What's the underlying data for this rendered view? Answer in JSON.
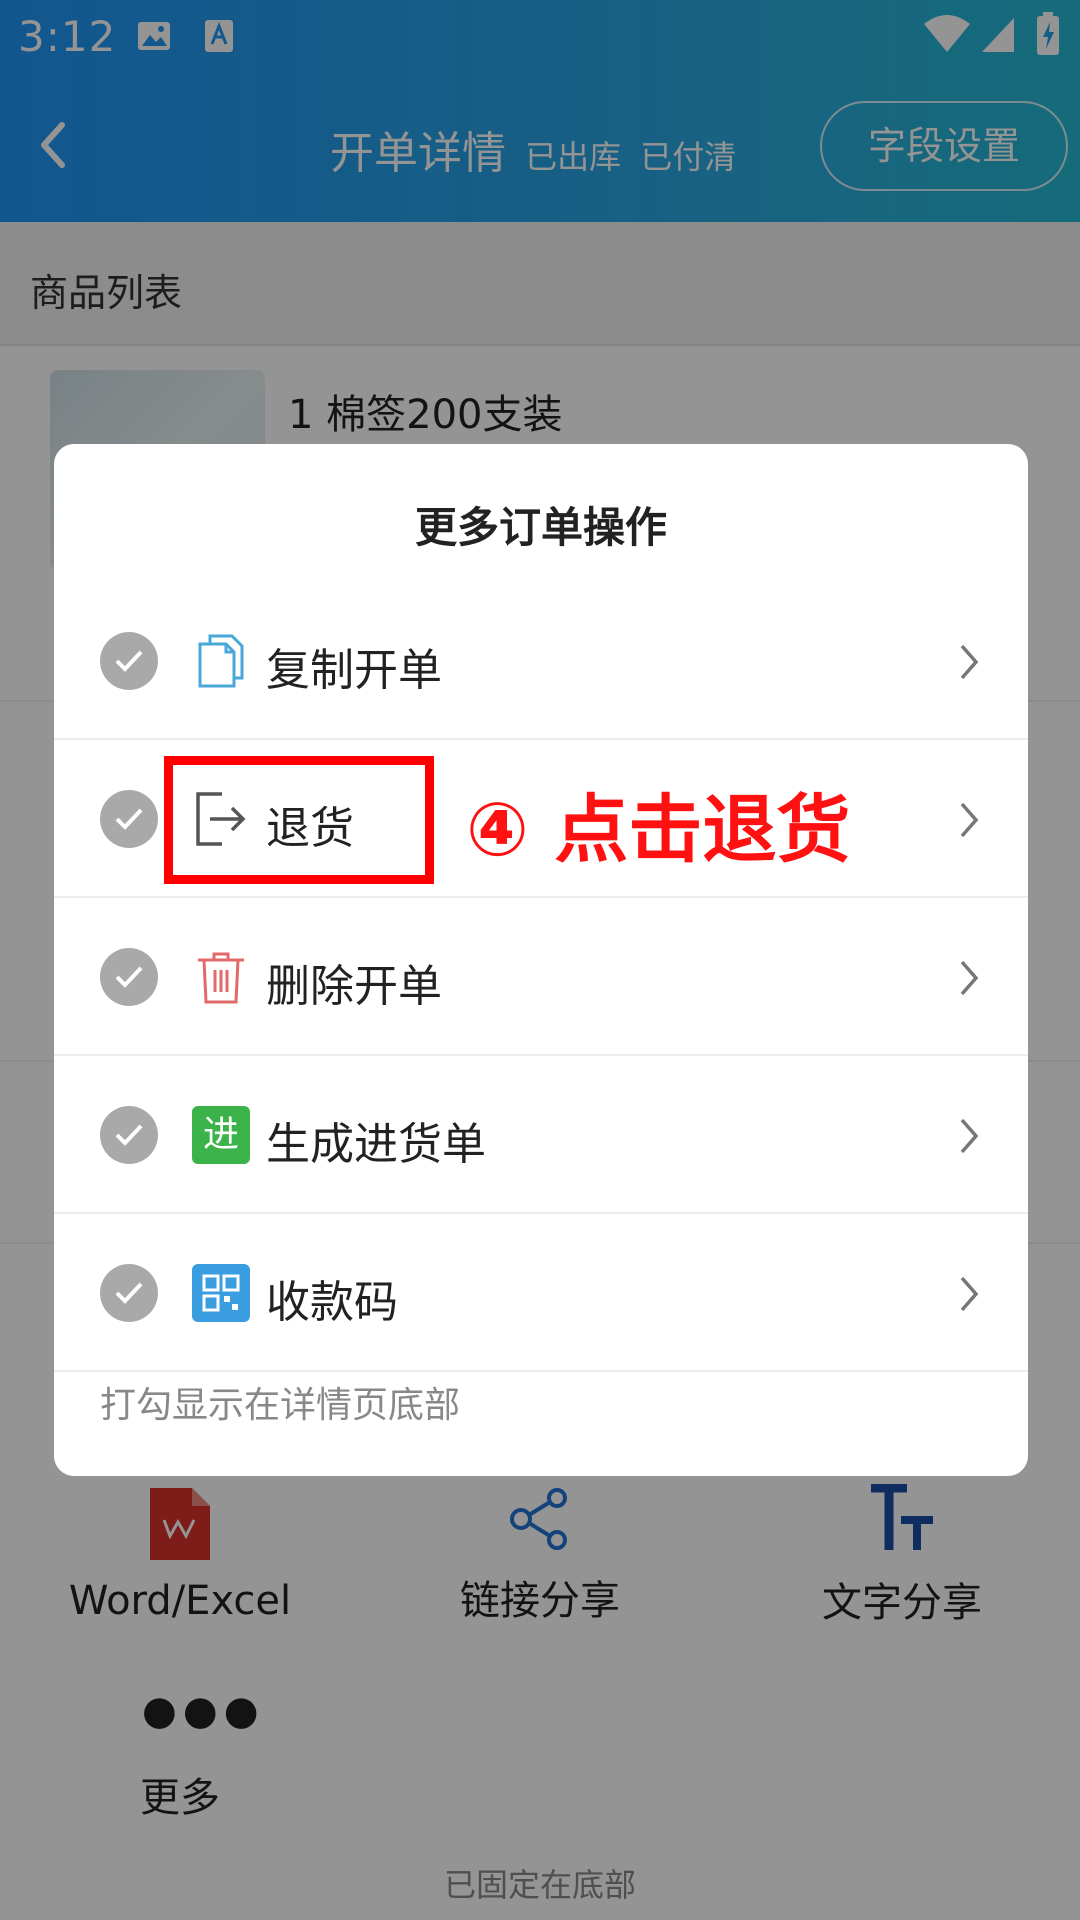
{
  "status_bar": {
    "time": "3:12"
  },
  "header": {
    "title": "开单详情",
    "tag_stock": "已出库",
    "tag_paid": "已付清",
    "settings_button": "字段设置"
  },
  "page": {
    "section_label": "商品列表",
    "product_name": "1 棉签200支装",
    "share_items": [
      {
        "label": "Word/Excel",
        "icon": "word-excel-icon"
      },
      {
        "label": "链接分享",
        "icon": "share-link-icon"
      },
      {
        "label": "文字分享",
        "icon": "text-size-icon"
      }
    ],
    "more_label": "更多",
    "footer_note": "已固定在底部"
  },
  "modal": {
    "title": "更多订单操作",
    "items": [
      {
        "label": "复制开单",
        "icon": "copy-document-icon"
      },
      {
        "label": "退货",
        "icon": "return-exit-icon"
      },
      {
        "label": "删除开单",
        "icon": "trash-icon"
      },
      {
        "label": "生成进货单",
        "icon": "purchase-badge-icon",
        "badge": "进"
      },
      {
        "label": "收款码",
        "icon": "qr-code-icon"
      }
    ],
    "hint": "打勾显示在详情页底部"
  },
  "annotation": {
    "callout_text": "④ 点击退货",
    "color": "#ff0000"
  },
  "colors": {
    "header_start": "#1e95f5",
    "header_end": "#26b9d3",
    "check_gray": "#a9a9a9",
    "purchase_green": "#3bb34a",
    "qr_blue": "#3a9de0",
    "trash_red": "#e36a6a",
    "copy_blue": "#4aa8d8"
  }
}
